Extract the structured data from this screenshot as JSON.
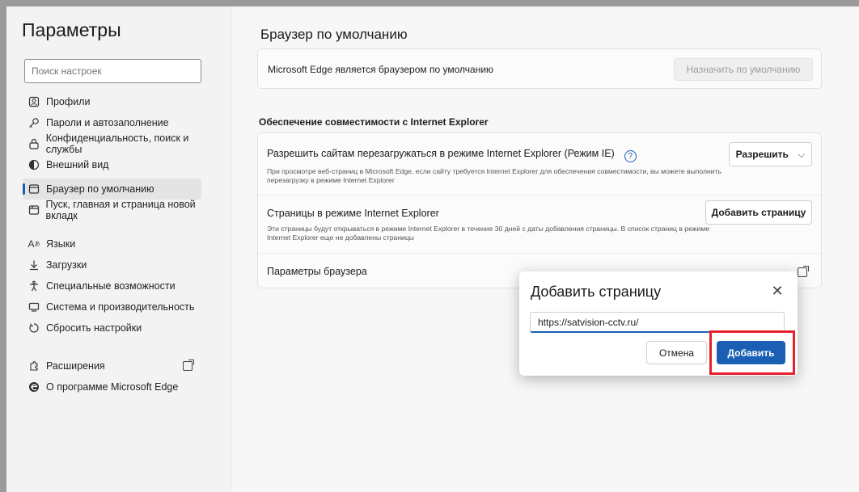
{
  "sidebar": {
    "title": "Параметры",
    "search_placeholder": "Поиск настроек",
    "items": [
      {
        "label": "Профили",
        "icon": "profile-icon"
      },
      {
        "label": "Пароли и автозаполнение",
        "icon": "key-icon"
      },
      {
        "label": "Конфиденциальность, поиск и службы",
        "icon": "lock-icon"
      },
      {
        "label": "Внешний вид",
        "icon": "appearance-icon"
      },
      {
        "label": "Браузер по умолчанию",
        "icon": "browser-icon",
        "active": true
      },
      {
        "label": "Пуск, главная и страница новой вкладк",
        "icon": "home-icon"
      },
      {
        "label": "Языки",
        "icon": "language-icon"
      },
      {
        "label": "Загрузки",
        "icon": "download-icon"
      },
      {
        "label": "Специальные возможности",
        "icon": "accessibility-icon"
      },
      {
        "label": "Система и производительность",
        "icon": "system-icon"
      },
      {
        "label": "Сбросить настройки",
        "icon": "reset-icon"
      },
      {
        "label": "Расширения",
        "icon": "extensions-icon"
      },
      {
        "label": "О программе Microsoft Edge",
        "icon": "edge-icon"
      }
    ]
  },
  "main": {
    "title": "Браузер по умолчанию",
    "default_status": "Microsoft Edge является браузером по умолчанию",
    "set_default_button": "Назначить по умолчанию",
    "ie_section_title": "Обеспечение совместимости с Internet Explorer",
    "ie_reload_title": "Разрешить сайтам перезагружаться в режиме Internet Explorer (Режим IE)",
    "ie_reload_desc": "При просмотре веб-страниц в Microsoft Edge, если сайту требуется Internet Explorer для обеспечения совместимости, вы можете выполнить перезагрузку в режиме Internet Explorer",
    "ie_reload_button": "Разрешить",
    "ie_pages_title": "Страницы в режиме Internet Explorer",
    "ie_pages_desc": "Эти страницы будут открываться в режиме Internet Explorer в течение 30 дней с даты добавления страницы. В список страниц в режиме Internet Explorer еще не добавлены страницы",
    "add_page_button": "Добавить страницу",
    "browser_settings": "Параметры браузера"
  },
  "dialog": {
    "title": "Добавить страницу",
    "url_value": "https://satvision-cctv.ru/",
    "cancel_label": "Отмена",
    "add_label": "Добавить"
  },
  "colors": {
    "accent": "#1a5fb4",
    "highlight": "#e8202b"
  }
}
